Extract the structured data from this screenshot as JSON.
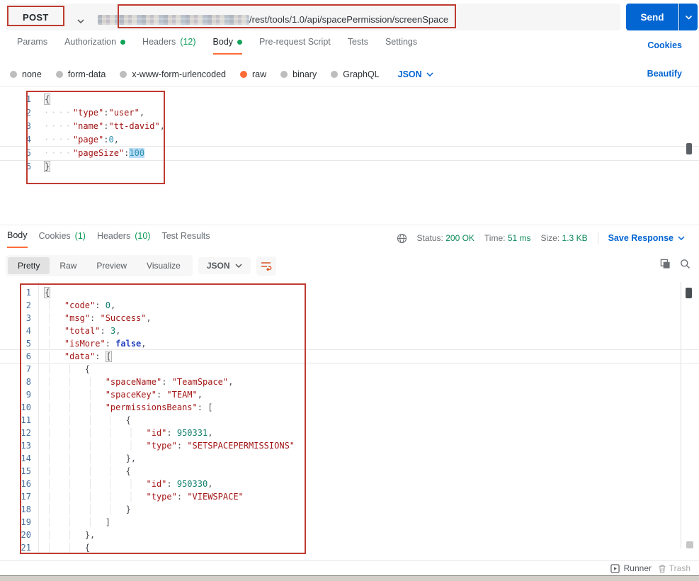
{
  "request": {
    "method": "POST",
    "url_visible_path": "/rest/tools/1.0/api/spacePermission/screenSpace",
    "send": "Send",
    "tabs": [
      {
        "label": "Params"
      },
      {
        "label": "Authorization"
      },
      {
        "label": "Headers",
        "count": "(12)"
      },
      {
        "label": "Body"
      },
      {
        "label": "Pre-request Script"
      },
      {
        "label": "Tests"
      },
      {
        "label": "Settings"
      }
    ],
    "cookies_link": "Cookies",
    "body_modes": [
      "none",
      "form-data",
      "x-www-form-urlencoded",
      "raw",
      "binary",
      "GraphQL"
    ],
    "selected_mode": "raw",
    "format": "JSON",
    "beautify": "Beautify"
  },
  "request_editor": {
    "active_line": 5,
    "lines": [
      [
        {
          "c": "br",
          "t": "{"
        }
      ],
      [
        {
          "c": "w",
          "t": "····"
        },
        {
          "c": "k",
          "t": "\"type\""
        },
        {
          "c": "p",
          "t": ":"
        },
        {
          "c": "k",
          "t": "\"user\""
        },
        {
          "c": "p",
          "t": ","
        }
      ],
      [
        {
          "c": "w",
          "t": "····"
        },
        {
          "c": "k",
          "t": "\"name\""
        },
        {
          "c": "p",
          "t": ":"
        },
        {
          "c": "k",
          "t": "\"tt-david\""
        },
        {
          "c": "p",
          "t": ","
        }
      ],
      [
        {
          "c": "w",
          "t": "····"
        },
        {
          "c": "k",
          "t": "\"page\""
        },
        {
          "c": "p",
          "t": ":"
        },
        {
          "c": "n",
          "t": "0"
        },
        {
          "c": "p",
          "t": ","
        }
      ],
      [
        {
          "c": "w",
          "t": "····"
        },
        {
          "c": "k",
          "t": "\"pageSize\""
        },
        {
          "c": "p",
          "t": ":"
        },
        {
          "c": "ns",
          "t": "100"
        }
      ],
      [
        {
          "c": "br",
          "t": "}"
        }
      ]
    ]
  },
  "response": {
    "tabs": [
      {
        "label": "Body"
      },
      {
        "label": "Cookies",
        "count": "(1)"
      },
      {
        "label": "Headers",
        "count": "(10)"
      },
      {
        "label": "Test Results"
      }
    ],
    "status_label": "Status:",
    "status_value": "200 OK",
    "time_label": "Time:",
    "time_value": "51 ms",
    "size_label": "Size:",
    "size_value": "1.3 KB",
    "save_response": "Save Response",
    "views": [
      "Pretty",
      "Raw",
      "Preview",
      "Visualize"
    ],
    "active_view": "Pretty",
    "format": "JSON"
  },
  "response_editor": {
    "active_line": 6,
    "lines": [
      [
        {
          "c": "br",
          "t": "{"
        }
      ],
      [
        {
          "c": "ws",
          "t": "    "
        },
        {
          "c": "k",
          "t": "\"code\""
        },
        {
          "c": "p",
          "t": ": "
        },
        {
          "c": "n",
          "t": "0"
        },
        {
          "c": "p",
          "t": ","
        }
      ],
      [
        {
          "c": "ws",
          "t": "    "
        },
        {
          "c": "k",
          "t": "\"msg\""
        },
        {
          "c": "p",
          "t": ": "
        },
        {
          "c": "k",
          "t": "\"Success\""
        },
        {
          "c": "p",
          "t": ","
        }
      ],
      [
        {
          "c": "ws",
          "t": "    "
        },
        {
          "c": "k",
          "t": "\"total\""
        },
        {
          "c": "p",
          "t": ": "
        },
        {
          "c": "n",
          "t": "3"
        },
        {
          "c": "p",
          "t": ","
        }
      ],
      [
        {
          "c": "ws",
          "t": "    "
        },
        {
          "c": "k",
          "t": "\"isMore\""
        },
        {
          "c": "p",
          "t": ": "
        },
        {
          "c": "b",
          "t": "false"
        },
        {
          "c": "p",
          "t": ","
        }
      ],
      [
        {
          "c": "ws",
          "t": "    "
        },
        {
          "c": "k",
          "t": "\"data\""
        },
        {
          "c": "p",
          "t": ": "
        },
        {
          "c": "br",
          "t": "["
        }
      ],
      [
        {
          "c": "ws",
          "t": "        "
        },
        {
          "c": "p",
          "t": "{"
        }
      ],
      [
        {
          "c": "ws",
          "t": "            "
        },
        {
          "c": "k",
          "t": "\"spaceName\""
        },
        {
          "c": "p",
          "t": ": "
        },
        {
          "c": "k",
          "t": "\"TeamSpace\""
        },
        {
          "c": "p",
          "t": ","
        }
      ],
      [
        {
          "c": "ws",
          "t": "            "
        },
        {
          "c": "k",
          "t": "\"spaceKey\""
        },
        {
          "c": "p",
          "t": ": "
        },
        {
          "c": "k",
          "t": "\"TEAM\""
        },
        {
          "c": "p",
          "t": ","
        }
      ],
      [
        {
          "c": "ws",
          "t": "            "
        },
        {
          "c": "k",
          "t": "\"permissionsBeans\""
        },
        {
          "c": "p",
          "t": ": "
        },
        {
          "c": "p",
          "t": "["
        }
      ],
      [
        {
          "c": "ws",
          "t": "                "
        },
        {
          "c": "p",
          "t": "{"
        }
      ],
      [
        {
          "c": "ws",
          "t": "                    "
        },
        {
          "c": "k",
          "t": "\"id\""
        },
        {
          "c": "p",
          "t": ": "
        },
        {
          "c": "n",
          "t": "950331"
        },
        {
          "c": "p",
          "t": ","
        }
      ],
      [
        {
          "c": "ws",
          "t": "                    "
        },
        {
          "c": "k",
          "t": "\"type\""
        },
        {
          "c": "p",
          "t": ": "
        },
        {
          "c": "k",
          "t": "\"SETSPACEPERMISSIONS\""
        }
      ],
      [
        {
          "c": "ws",
          "t": "                "
        },
        {
          "c": "p",
          "t": "},"
        }
      ],
      [
        {
          "c": "ws",
          "t": "                "
        },
        {
          "c": "p",
          "t": "{"
        }
      ],
      [
        {
          "c": "ws",
          "t": "                    "
        },
        {
          "c": "k",
          "t": "\"id\""
        },
        {
          "c": "p",
          "t": ": "
        },
        {
          "c": "n",
          "t": "950330"
        },
        {
          "c": "p",
          "t": ","
        }
      ],
      [
        {
          "c": "ws",
          "t": "                    "
        },
        {
          "c": "k",
          "t": "\"type\""
        },
        {
          "c": "p",
          "t": ": "
        },
        {
          "c": "k",
          "t": "\"VIEWSPACE\""
        }
      ],
      [
        {
          "c": "ws",
          "t": "                "
        },
        {
          "c": "p",
          "t": "}"
        }
      ],
      [
        {
          "c": "ws",
          "t": "            "
        },
        {
          "c": "p",
          "t": "]"
        }
      ],
      [
        {
          "c": "ws",
          "t": "        "
        },
        {
          "c": "p",
          "t": "},"
        }
      ],
      [
        {
          "c": "ws",
          "t": "        "
        },
        {
          "c": "p",
          "t": "{"
        }
      ]
    ]
  },
  "footer": {
    "runner": "Runner",
    "trash": "Trash"
  },
  "colors": {
    "accent": "#FF6C37",
    "link": "#0265D2",
    "success": "#0E8A5A",
    "annotation": "#BF3B30",
    "send_blue": "#0265D2"
  }
}
